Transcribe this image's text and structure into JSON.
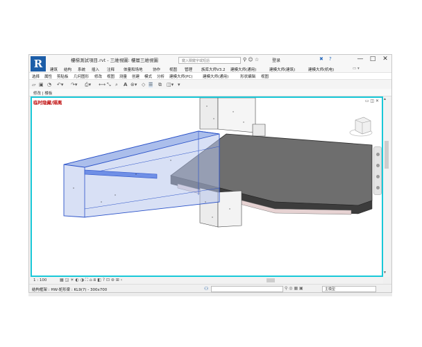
{
  "window": {
    "title": "樓梯測試項目.rvt - 三維視圖: 樓層三維視圖",
    "search_placeholder": "鍵入關鍵字或短語",
    "login_label": "登录",
    "controls": [
      "—",
      "□",
      "✕"
    ]
  },
  "menu": {
    "items": [
      "建筑",
      "结构",
      "系统",
      "插入",
      "注释",
      "体量和场地",
      "协作",
      "视图",
      "管理",
      "族库大师V3.2",
      "建模大师(通用)",
      "建模大师(建筑)",
      "建模大师(机电)"
    ]
  },
  "ribbon": {
    "items": [
      "选择",
      "属性",
      "剪贴板",
      "几何图形",
      "修改",
      "视图",
      "测量",
      "创建",
      "模式",
      "分析",
      "建模大师(PC)",
      "建模大师(通用)",
      "形状编辑",
      "视图"
    ]
  },
  "properties": {
    "label": "修改 | 楼板"
  },
  "view": {
    "label": "临时隐藏/隔离",
    "scale": "1 : 100"
  },
  "status": {
    "text": "结构框架 : HW-矩形梁 : KL9(7) - 300x700",
    "model": "主模型"
  },
  "icons": [
    "revit-logo-icon",
    "search-icon",
    "star-icon",
    "user-icon",
    "help-icon",
    "minimize-icon",
    "maximize-icon",
    "close-icon",
    "viewcube-icon",
    "navigation-bar-icon"
  ],
  "colors": {
    "accent": "#18c8d8",
    "selection": "#2850c8",
    "label_red": "#c01010",
    "slab_top": "#6e6e6e"
  }
}
